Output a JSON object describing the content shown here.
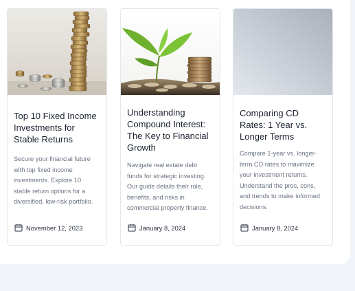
{
  "cards": [
    {
      "title": "Top 10 Fixed Income Investments for Stable Returns",
      "description": "Secure your financial future with top fixed income investments. Explore 10 stable return options for a diversified, low-risk portfolio.",
      "date": "November 12, 2023",
      "image": "stacked-coins-photo"
    },
    {
      "title": "Understanding Compound Interest: The Key to Financial Growth",
      "description": "Navigate real estate debt funds for strategic investing. Our guide details their role, benefits, and risks in commercial property finance.",
      "date": "January 8, 2024",
      "image": "plant-growing-from-coins-photo"
    },
    {
      "title": "Comparing CD Rates: 1 Year vs. Longer Terms",
      "description": "Compare 1-year vs. longer-term CD rates to maximize your investment returns. Understand the pros, cons, and trends to make informed decisions.",
      "date": "January 8, 2024",
      "image": "gray-gradient-placeholder"
    }
  ],
  "icons": {
    "date": "calendar-icon"
  },
  "colors": {
    "title": "#1b2230",
    "text": "#6b7483",
    "border": "#e3e6ea",
    "background": "#f1f4f8"
  }
}
